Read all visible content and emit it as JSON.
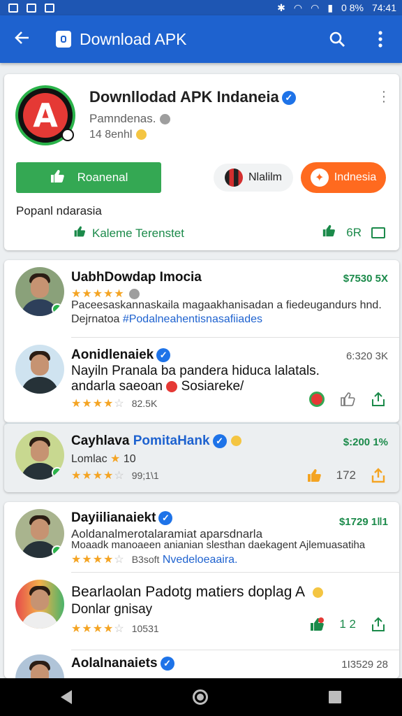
{
  "status": {
    "battery": "0 8%",
    "time": "74:41"
  },
  "appbar": {
    "title": "Download APK"
  },
  "app": {
    "title": "Downllodad APK Indaneia",
    "subtitle": "Pamndenas.",
    "rating": "14 8enhl",
    "primary_button": "Roanenal",
    "secondary_button": "Nlalilm",
    "orange_button": "Indnesia",
    "popular": "Popanl ndarasia",
    "kaleme": "Kaleme Terenstet",
    "stat": "6R"
  },
  "items": [
    {
      "name": "UabhDowdap Imocia",
      "price": "$7530 5X",
      "line1": "Paceesaskannaskaila magaakhanisadan a fiedeugandurs hnd.",
      "line2_prefix": "Dejrnatoa ",
      "line2_tag": "#Podalneahentisnasafiiades"
    },
    {
      "name": "Aonidlenaiek",
      "price": "6:320 3K",
      "line1": "Nayiln Pranala ba pandera hiduca lalatals.",
      "line2": "andarla saeoan",
      "line2_suffix": "Sosiareke/",
      "rating_count": "82.5K"
    },
    {
      "name": "Cayhlava",
      "name_blue": "PomitaHank",
      "price": "$:200 1%",
      "line1": "Lomlac",
      "line1_suffix": "10",
      "rating_count": "99;1\\1",
      "count": "172"
    },
    {
      "name": "Dayiilianaiekt",
      "price": "$1729 1‖1",
      "line1": "Aoldanalmerotalaramiat aparsdnarla",
      "line2": "Moaadk manoaeen anianian slesthan daekagent Ajlemuasatiha",
      "rating_count": "B3soft",
      "tag": "Nvedeloeaaira."
    },
    {
      "name": "Bearlaolan Padotg matiers doplag A",
      "line1": "Donlar gnisay",
      "rating_count": "10531",
      "count": "1 2"
    },
    {
      "name": "Aolalnanaiets",
      "price": "1I3529 28"
    }
  ],
  "colors": {
    "primary": "#1e62cf",
    "green": "#34a853",
    "orange": "#ff6a1f"
  }
}
